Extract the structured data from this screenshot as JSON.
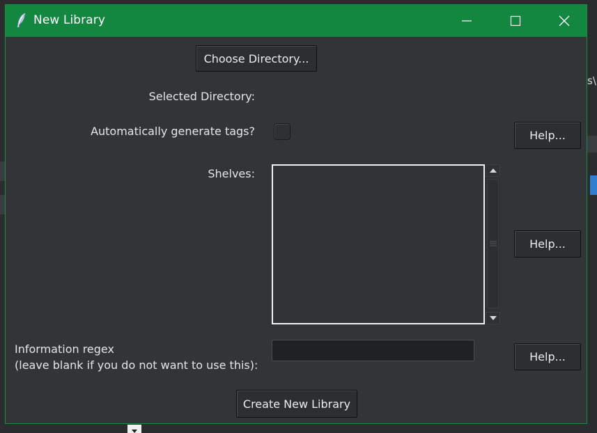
{
  "window": {
    "title": "New Library"
  },
  "background": {
    "peek_text": "s\\"
  },
  "form": {
    "choose_directory_label": "Choose Directory...",
    "selected_directory_label": "Selected Directory:",
    "auto_tags_label": "Automatically generate tags?",
    "auto_tags_checked": false,
    "shelves_label": "Shelves:",
    "regex_label_line1": "Information regex",
    "regex_label_line2": "(leave blank if you do not want to use this):",
    "regex_value": "",
    "help_label": "Help...",
    "create_label": "Create New Library"
  },
  "icons": {
    "app": "feather-icon",
    "minimize": "minimize-icon",
    "maximize": "maximize-icon",
    "close": "close-icon"
  },
  "colors": {
    "titlebar": "#13873f",
    "window_bg": "#323537",
    "text": "#e6e6e6"
  }
}
